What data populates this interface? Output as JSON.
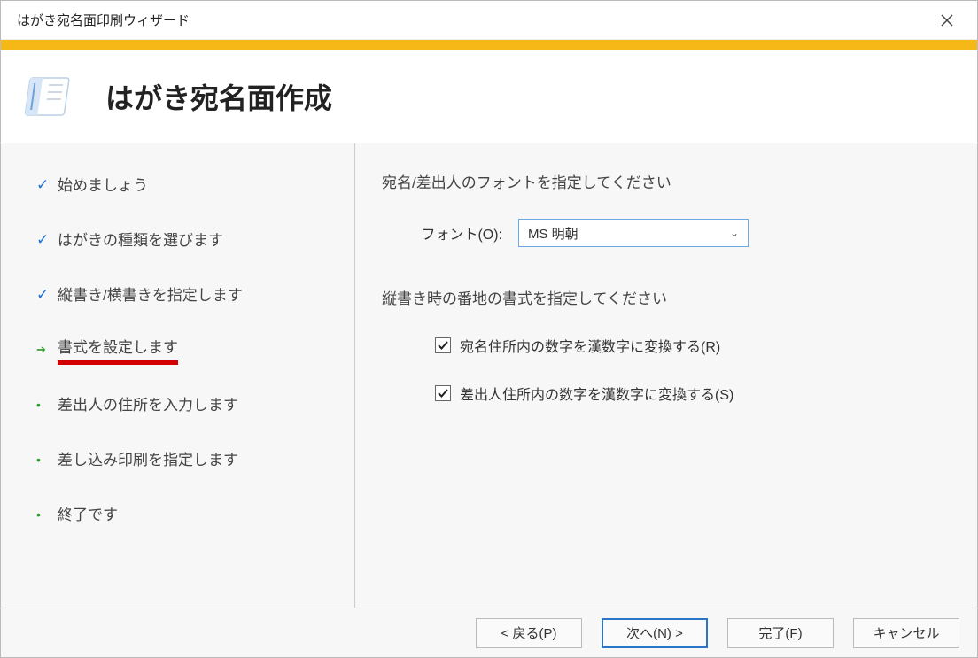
{
  "window": {
    "title": "はがき宛名面印刷ウィザード"
  },
  "header": {
    "title": "はがき宛名面作成"
  },
  "steps": [
    {
      "label": "始めましょう",
      "state": "done"
    },
    {
      "label": "はがきの種類を選びます",
      "state": "done"
    },
    {
      "label": "縦書き/横書きを指定します",
      "state": "done"
    },
    {
      "label": "書式を設定します",
      "state": "current"
    },
    {
      "label": "差出人の住所を入力します",
      "state": "pending"
    },
    {
      "label": "差し込み印刷を指定します",
      "state": "pending"
    },
    {
      "label": "終了です",
      "state": "pending"
    }
  ],
  "content": {
    "font_section_label": "宛名/差出人のフォントを指定してください",
    "font_label": "フォント(O):",
    "font_value": "MS 明朝",
    "address_section_label": "縦書き時の番地の書式を指定してください",
    "checkbox1_label": "宛名住所内の数字を漢数字に変換する(R)",
    "checkbox1_checked": true,
    "checkbox2_label": "差出人住所内の数字を漢数字に変換する(S)",
    "checkbox2_checked": true
  },
  "footer": {
    "back": "< 戻る(P)",
    "next": "次へ(N) >",
    "finish": "完了(F)",
    "cancel": "キャンセル"
  }
}
